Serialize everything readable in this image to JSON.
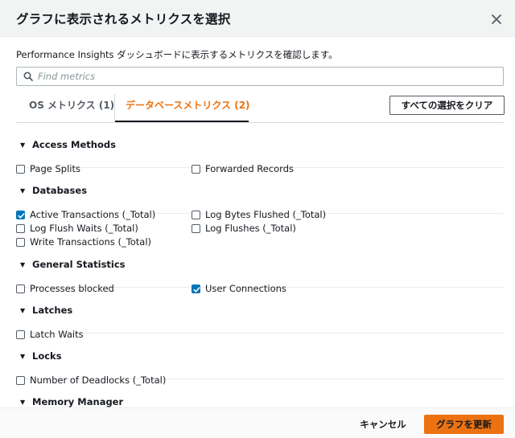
{
  "dialog": {
    "title": "グラフに表示されるメトリクスを選択",
    "description": "Performance Insights ダッシュボードに表示するメトリクスを確認します。"
  },
  "search": {
    "placeholder": "Find metrics",
    "value": ""
  },
  "tabs": [
    {
      "label": "OS メトリクス (1)",
      "selected": false
    },
    {
      "label": "データベースメトリクス (2)",
      "selected": true
    }
  ],
  "clear_button": "すべての選択をクリア",
  "sections": [
    {
      "label": "Access Methods",
      "items": [
        {
          "label": "Page Splits",
          "checked": false
        },
        {
          "label": "Forwarded Records",
          "checked": false
        }
      ]
    },
    {
      "label": "Databases",
      "items": [
        {
          "label": "Active Transactions (_Total)",
          "checked": true
        },
        {
          "label": "Log Bytes Flushed (_Total)",
          "checked": false
        },
        {
          "label": "Log Flush Waits (_Total)",
          "checked": false
        },
        {
          "label": "Log Flushes (_Total)",
          "checked": false
        },
        {
          "label": "Write Transactions (_Total)",
          "checked": false
        }
      ]
    },
    {
      "label": "General Statistics",
      "items": [
        {
          "label": "Processes blocked",
          "checked": false
        },
        {
          "label": "User Connections",
          "checked": true
        }
      ]
    },
    {
      "label": "Latches",
      "items": [
        {
          "label": "Latch Waits",
          "checked": false
        }
      ]
    },
    {
      "label": "Locks",
      "items": [
        {
          "label": "Number of Deadlocks (_Total)",
          "checked": false
        }
      ]
    },
    {
      "label": "Memory Manager",
      "items": []
    }
  ],
  "footer": {
    "cancel_label": "キャンセル",
    "update_label": "グラフを更新"
  },
  "colors": {
    "accent": "#ec7211",
    "checkbox_checked": "#0073bb",
    "header_bg": "#f2f3f3"
  },
  "icons": {
    "close": "close-icon",
    "search": "search-icon",
    "caret": "caret-down-icon",
    "check": "check-icon"
  }
}
